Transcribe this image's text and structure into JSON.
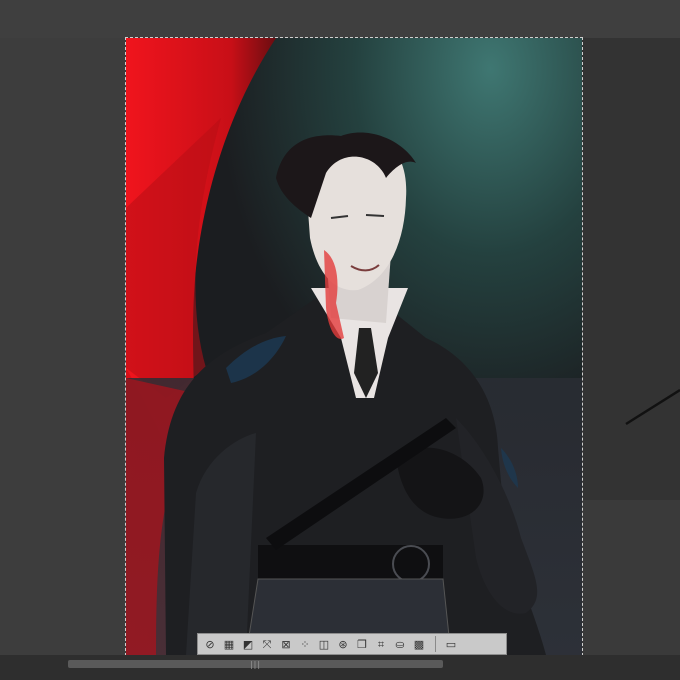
{
  "colors": {
    "workspace_bg": "#3d3d3d",
    "toolbar_bg": "#c9c9c9",
    "canvas_red": "#e50d16",
    "canvas_teal": "#2f5553",
    "canvas_dark": "#262a31"
  },
  "transform_toolbar": {
    "tools": [
      {
        "icon": "flip-icon",
        "glyph": "⊘"
      },
      {
        "icon": "select-grid-icon",
        "glyph": "▦"
      },
      {
        "icon": "clear-icon",
        "glyph": "◩"
      },
      {
        "icon": "scale-icon",
        "glyph": "⤧"
      },
      {
        "icon": "transform-icon",
        "glyph": "⊠"
      },
      {
        "icon": "mesh-icon",
        "glyph": "⁘"
      },
      {
        "icon": "fit-canvas-icon",
        "glyph": "◫"
      },
      {
        "icon": "free-transform-icon",
        "glyph": "⊛"
      },
      {
        "icon": "duplicate-icon",
        "glyph": "❐"
      },
      {
        "icon": "crop-icon",
        "glyph": "⌗"
      },
      {
        "icon": "fill-icon",
        "glyph": "⛀"
      },
      {
        "icon": "checker-icon",
        "glyph": "▩"
      },
      {
        "icon": "ruler-icon",
        "glyph": "▭"
      }
    ]
  },
  "scrollbar": {
    "grip": "|||"
  }
}
